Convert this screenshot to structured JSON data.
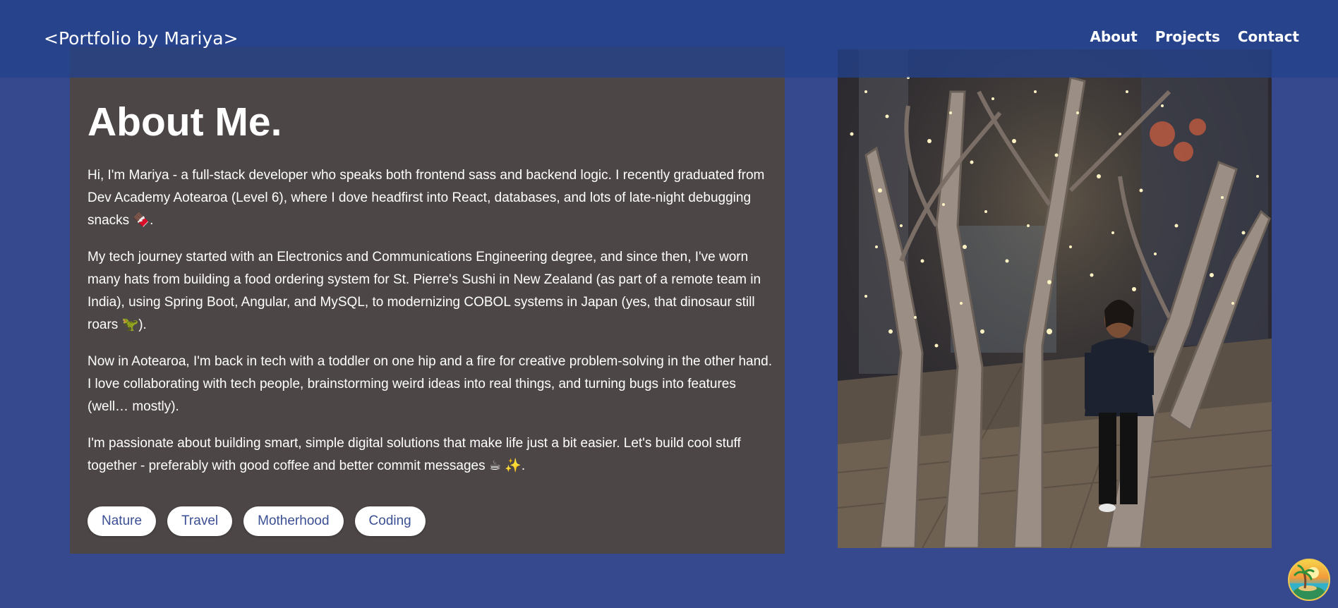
{
  "header": {
    "logo": "<Portfolio by Mariya>",
    "nav": [
      "About",
      "Projects",
      "Contact"
    ]
  },
  "about": {
    "title": "About Me.",
    "paragraphs": [
      "Hi, I'm Mariya - a full-stack developer who speaks both frontend sass and backend logic. I recently graduated from Dev Academy Aotearoa (Level 6), where I dove headfirst into React, databases, and lots of late-night debugging snacks 🍫.",
      "My tech journey started with an Electronics and Communications Engineering degree, and since then, I've worn many hats from building a food ordering system for St. Pierre's Sushi in New Zealand (as part of a remote team in India), using Spring Boot, Angular, and MySQL, to modernizing COBOL systems in Japan (yes, that dinosaur still roars 🦖).",
      "Now in Aotearoa, I'm back in tech with a toddler on one hip and a fire for creative problem-solving in the other hand. I love collaborating with tech people, brainstorming weird ideas into real things, and turning bugs into features (well… mostly).",
      "I'm passionate about building smart, simple digital solutions that make life just a bit easier. Let's build cool stuff together - preferably with good coffee and better commit messages ☕ ✨."
    ],
    "tags": [
      "Nature",
      "Travel",
      "Motherhood",
      "Coding"
    ]
  },
  "colors": {
    "page_background": "#36498e",
    "header_background": "#23418c",
    "card_background": "#4d4646",
    "tag_text": "#3b4f94"
  },
  "icons": {
    "corner_badge": "palm-island-sunset-icon"
  }
}
